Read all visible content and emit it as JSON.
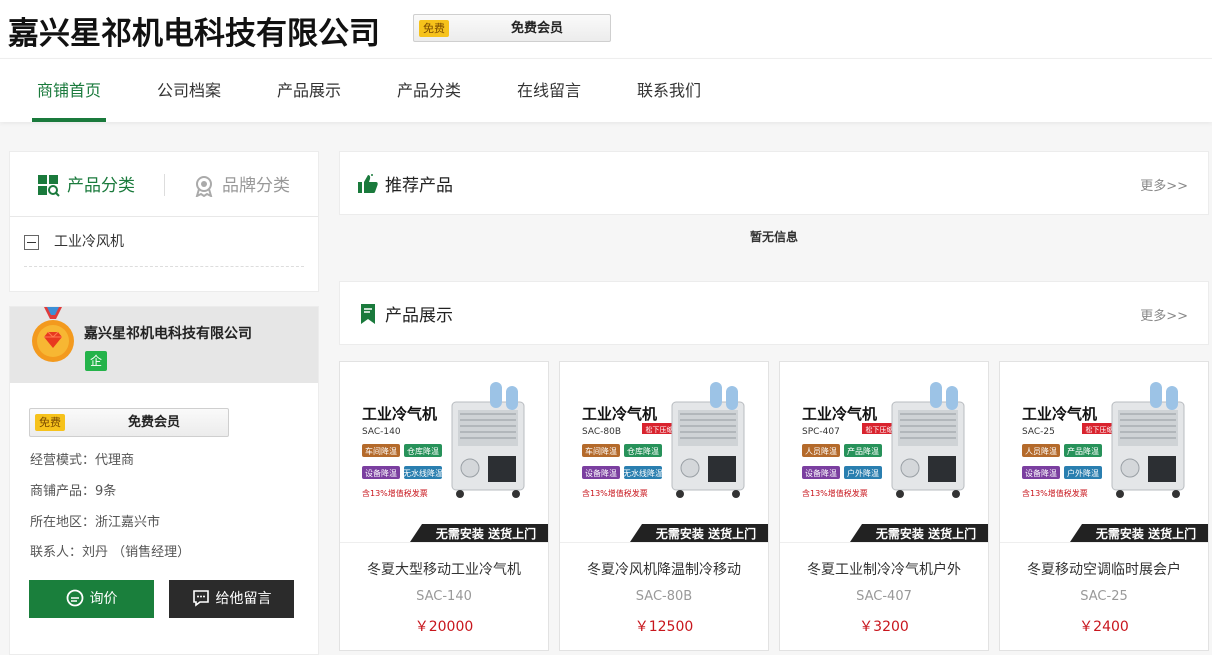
{
  "header": {
    "company_name": "嘉兴星祁机电科技有限公司",
    "member_tag": "免费",
    "member_label": "免费会员"
  },
  "nav": {
    "items": [
      "商铺首页",
      "公司档案",
      "产品展示",
      "产品分类",
      "在线留言",
      "联系我们"
    ],
    "active_index": 0
  },
  "sidebar": {
    "category_tabs": {
      "product": "产品分类",
      "brand": "品牌分类"
    },
    "categories": [
      "工业冷风机"
    ],
    "company": {
      "name": "嘉兴星祁机电科技有限公司",
      "qi_badge": "企",
      "member_tag": "免费",
      "member_label": "免费会员",
      "business_mode": "经营模式：代理商",
      "products": "商铺产品：9条",
      "region": "所在地区：浙江嘉兴市",
      "contact": "联系人：刘丹 （销售经理）"
    },
    "buttons": {
      "inquiry": "询价",
      "message": "给他留言"
    }
  },
  "recommended": {
    "title": "推荐产品",
    "more": "更多>>",
    "empty": "暂无信息"
  },
  "showcase": {
    "title": "产品展示",
    "more": "更多>>",
    "products": [
      {
        "name": "冬夏大型移动工业冷气机",
        "model": "SAC-140",
        "price": "￥20000",
        "img_title": "工业冷气机",
        "img_model": "SAC-140",
        "img_tag": "",
        "img_features": [
          "车间降温",
          "仓库降温",
          "设备降温",
          "无水线降温"
        ],
        "img_note": "含13%增值税发票",
        "img_banner": "无需安装   送货上门"
      },
      {
        "name": "冬夏冷风机降温制冷移动",
        "model": "SAC-80B",
        "price": "￥12500",
        "img_title": "工业冷气机",
        "img_model": "SAC-80B",
        "img_tag": "松下压缩机",
        "img_features": [
          "车间降温",
          "仓库降温",
          "设备降温",
          "无水线降温"
        ],
        "img_note": "含13%增值税发票",
        "img_banner": "无需安装   送货上门"
      },
      {
        "name": "冬夏工业制冷冷气机户外",
        "model": "SAC-407",
        "price": "￥3200",
        "img_title": "工业冷气机",
        "img_model": "SPC-407",
        "img_tag": "松下压缩机",
        "img_features": [
          "人员降温",
          "产品降温",
          "设备降温",
          "户外降温"
        ],
        "img_note": "含13%增值税发票",
        "img_banner": "无需安装   送货上门"
      },
      {
        "name": "冬夏移动空调临时展会户",
        "model": "SAC-25",
        "price": "￥2400",
        "img_title": "工业冷气机",
        "img_model": "SAC-25",
        "img_tag": "松下压缩机",
        "img_features": [
          "人员降温",
          "产品降温",
          "设备降温",
          "户外降温"
        ],
        "img_note": "含13%增值税发票",
        "img_banner": "无需安装   送货上门"
      }
    ]
  },
  "colors": {
    "brand_green": "#1a7a3c",
    "price_red": "#c8161d",
    "badge_yellow": "#f6c21b"
  }
}
